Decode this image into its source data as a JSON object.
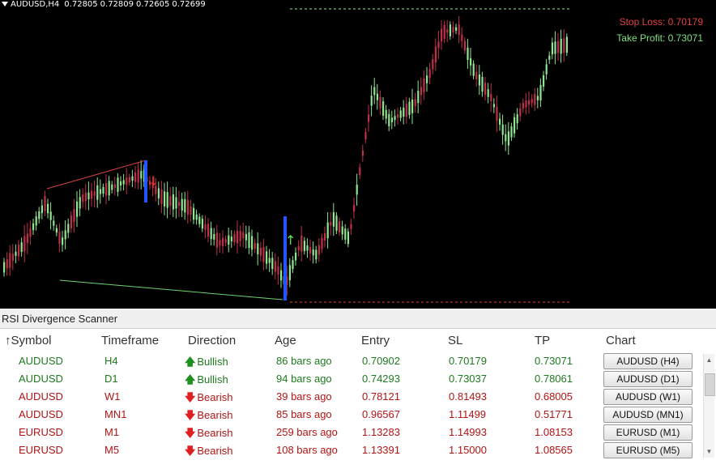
{
  "chart": {
    "symbol": "AUDUSD,H4",
    "quotes": [
      "0.72805",
      "0.72809",
      "0.72605",
      "0.72699"
    ],
    "stop_loss_text": "Stop Loss: 0.70179",
    "take_profit_text": "Take Profit: 0.73071",
    "colors": {
      "bull": "#8fe68f",
      "bear": "#c0304a",
      "bg": "#000000"
    }
  },
  "panel": {
    "title": "RSI Divergence Scanner",
    "columns": {
      "symbol": "Symbol",
      "timeframe": "Timeframe",
      "direction": "Direction",
      "age": "Age",
      "entry": "Entry",
      "sl": "SL",
      "tp": "TP",
      "chart": "Chart"
    },
    "rows": [
      {
        "symbol": "AUDUSD",
        "timeframe": "H4",
        "direction": "Bullish",
        "age": "86 bars ago",
        "entry": "0.70902",
        "sl": "0.70179",
        "tp": "0.73071",
        "button": "AUDUSD (H4)"
      },
      {
        "symbol": "AUDUSD",
        "timeframe": "D1",
        "direction": "Bullish",
        "age": "94 bars ago",
        "entry": "0.74293",
        "sl": "0.73037",
        "tp": "0.78061",
        "button": "AUDUSD (D1)"
      },
      {
        "symbol": "AUDUSD",
        "timeframe": "W1",
        "direction": "Bearish",
        "age": "39 bars ago",
        "entry": "0.78121",
        "sl": "0.81493",
        "tp": "0.68005",
        "button": "AUDUSD (W1)"
      },
      {
        "symbol": "AUDUSD",
        "timeframe": "MN1",
        "direction": "Bearish",
        "age": "85 bars ago",
        "entry": "0.96567",
        "sl": "1.11499",
        "tp": "0.51771",
        "button": "AUDUSD (MN1)"
      },
      {
        "symbol": "EURUSD",
        "timeframe": "M1",
        "direction": "Bearish",
        "age": "259 bars ago",
        "entry": "1.13283",
        "sl": "1.14993",
        "tp": "1.08153",
        "button": "EURUSD (M1)"
      },
      {
        "symbol": "EURUSD",
        "timeframe": "M5",
        "direction": "Bearish",
        "age": "108 bars ago",
        "entry": "1.13391",
        "sl": "1.15000",
        "tp": "1.08565",
        "button": "EURUSD (M5)"
      }
    ]
  }
}
